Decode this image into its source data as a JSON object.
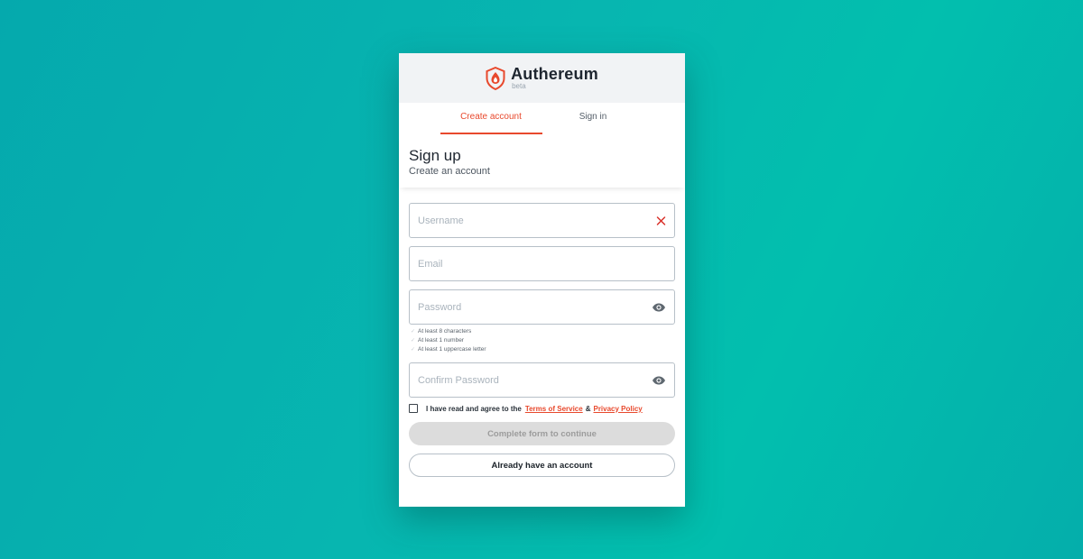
{
  "brand": {
    "name": "Authereum",
    "tag": "beta",
    "accent": "#e8492d"
  },
  "tabs": [
    {
      "label": "Create account",
      "active": true
    },
    {
      "label": "Sign in",
      "active": false
    }
  ],
  "heading": {
    "title": "Sign up",
    "subtitle": "Create an account"
  },
  "form": {
    "username": {
      "placeholder": "Username",
      "value": "",
      "trailing_icon": "clear-icon"
    },
    "email": {
      "placeholder": "Email",
      "value": ""
    },
    "password": {
      "placeholder": "Password",
      "value": "",
      "trailing_icon": "eye-icon"
    },
    "password_rules": [
      "At least 8 characters",
      "At least 1 number",
      "At least 1 uppercase letter"
    ],
    "confirm_password": {
      "placeholder": "Confirm Password",
      "value": "",
      "trailing_icon": "eye-icon"
    },
    "terms": {
      "prefix": "I have read and agree to the",
      "tos_label": "Terms of Service",
      "amp": "&",
      "privacy_label": "Privacy Policy",
      "checked": false
    },
    "submit_label": "Complete form to continue",
    "existing_label": "Already have an account"
  }
}
